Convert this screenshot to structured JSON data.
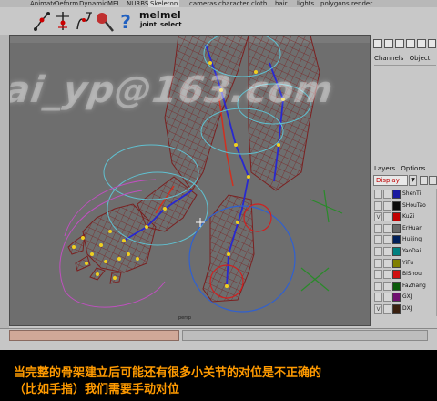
{
  "tabs": [
    "Animate",
    "Deform",
    "Dynamic",
    "MEL",
    "NURBS",
    "Skeleton",
    "cameras",
    "character",
    "cloth",
    "hair",
    "lights",
    "polygons",
    "render"
  ],
  "shelf": {
    "mel_buttons": [
      {
        "label": "joint"
      },
      {
        "label": "select"
      }
    ],
    "mel_glyph": "mel"
  },
  "viewport": {
    "watermark": "ai_yp@163.com",
    "camera_label": "persp"
  },
  "right_panel": {
    "channels_label": "Channels",
    "object_label": "Object",
    "layers_label": "Layers",
    "options_label": "Options",
    "display_value": "Display",
    "layers": [
      {
        "name": "ShenTi",
        "visible": "",
        "color": "#1a1aa0"
      },
      {
        "name": "SHouTao",
        "visible": "",
        "color": "#0a0a0a"
      },
      {
        "name": "KuZi",
        "visible": "V",
        "color": "#c00000"
      },
      {
        "name": "ErHuan",
        "visible": "",
        "color": "#6a6a6a"
      },
      {
        "name": "HuiJing",
        "visible": "",
        "color": "#001f5a"
      },
      {
        "name": "YaoDai",
        "visible": "",
        "color": "#008080"
      },
      {
        "name": "YiFu",
        "visible": "",
        "color": "#808000"
      },
      {
        "name": "BiShou",
        "visible": "",
        "color": "#d01010"
      },
      {
        "name": "FaZhang",
        "visible": "",
        "color": "#0a5a0a"
      },
      {
        "name": "GXJ",
        "visible": "",
        "color": "#701070"
      },
      {
        "name": "DXJ",
        "visible": "V",
        "color": "#3a2010"
      }
    ]
  },
  "caption": {
    "line1": "当完整的骨架建立后可能还有很多小关节的对位是不正确的",
    "line2": "（比如手指）我们需要手动对位"
  }
}
